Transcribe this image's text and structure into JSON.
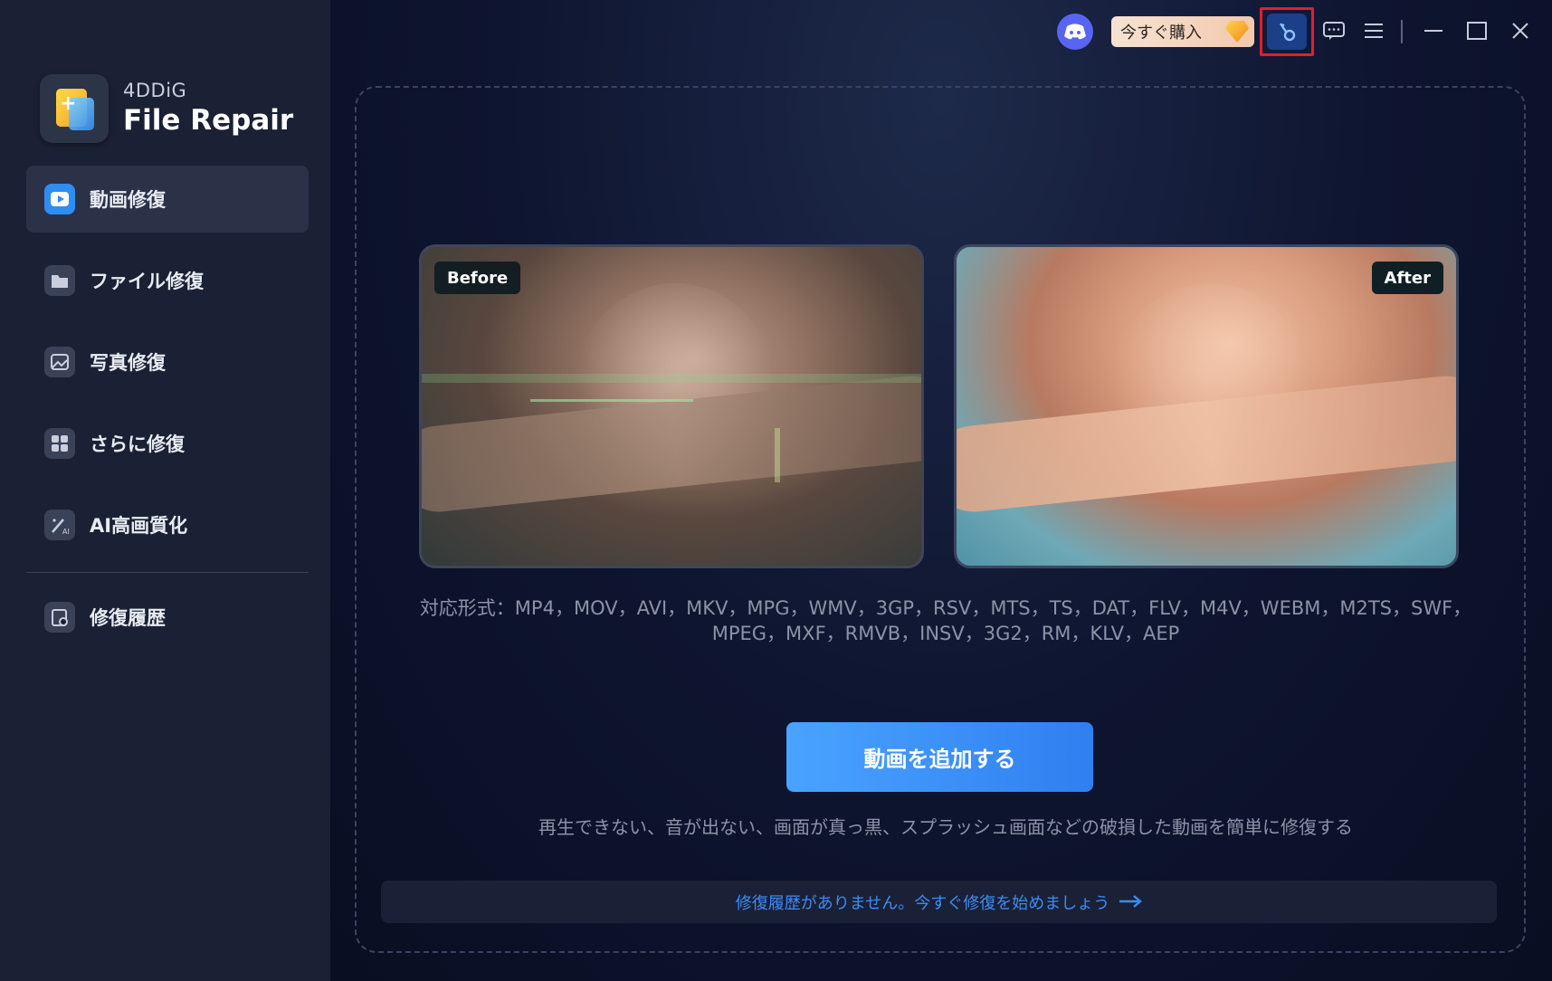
{
  "brand": {
    "small": "4DDiG",
    "big": "File Repair"
  },
  "sidebar": {
    "items": [
      {
        "label": "動画修復",
        "icon": "video-icon",
        "active": true
      },
      {
        "label": "ファイル修復",
        "icon": "folder-icon",
        "active": false
      },
      {
        "label": "写真修復",
        "icon": "image-icon",
        "active": false
      },
      {
        "label": "さらに修復",
        "icon": "grid-icon",
        "active": false
      },
      {
        "label": "AI高画質化",
        "icon": "ai-wand-icon",
        "active": false
      },
      {
        "label": "修復履歴",
        "icon": "history-clipboard-icon",
        "active": false
      }
    ]
  },
  "titlebar": {
    "buy_label": "今すぐ購入"
  },
  "preview": {
    "before_label": "Before",
    "after_label": "After"
  },
  "formats": {
    "line1": "対応形式：MP4，MOV，AVI，MKV，MPG，WMV，3GP，RSV，MTS，TS，DAT，FLV，M4V，WEBM，M2TS，SWF，",
    "line2": "MPEG，MXF，RMVB，INSV，3G2，RM，KLV，AEP"
  },
  "actions": {
    "add_video": "動画を追加する",
    "description": "再生できない、音が出ない、画面が真っ黒、スプラッシュ画面などの破損した動画を簡単に修復する"
  },
  "history_prompt": "修復履歴がありません。今すぐ修復を始めましょう",
  "colors": {
    "accent": "#2f8cf0",
    "highlight_border": "#e0202a"
  }
}
